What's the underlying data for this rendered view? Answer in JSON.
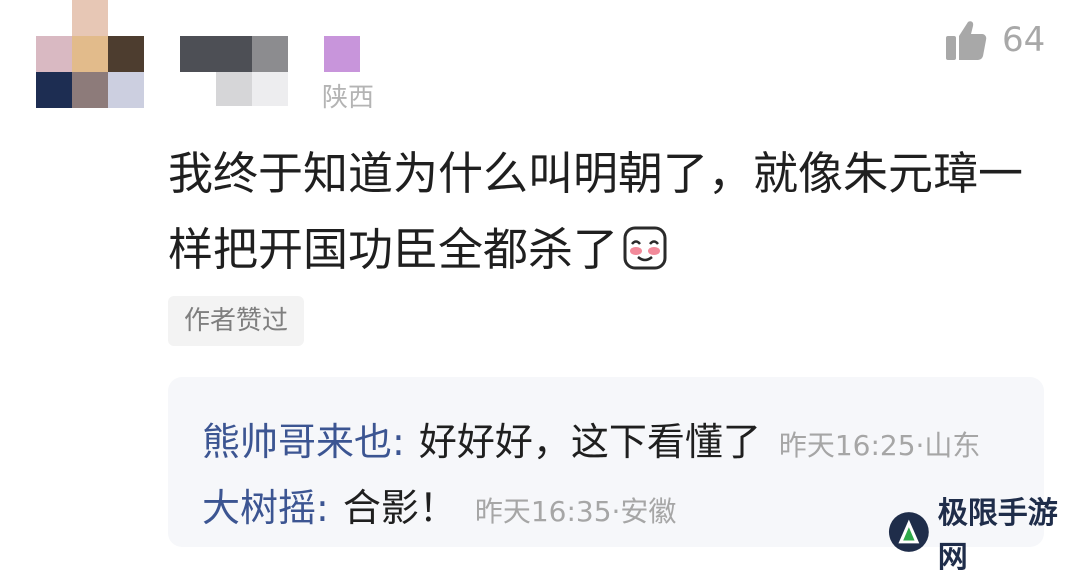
{
  "comment": {
    "location": "陕西",
    "like_count": "64",
    "text": "我终于知道为什么叫明朝了，就像朱元璋一样把开国功臣全都杀了",
    "author_liked_label": "作者赞过"
  },
  "replies": [
    {
      "name": "熊帅哥来也",
      "colon": ":",
      "text": "好好好，这下看懂了",
      "meta": "昨天16:25·山东"
    },
    {
      "name": "大树摇",
      "colon": ":",
      "text": "合影！",
      "meta": "昨天16:35·安徽"
    }
  ],
  "watermark": {
    "text": "极限手游网"
  },
  "colors": {
    "reply_name": "#3c5592",
    "body_text": "#1f1f1f",
    "muted": "#a6a6a6",
    "reply_bg": "#f6f7fa"
  }
}
